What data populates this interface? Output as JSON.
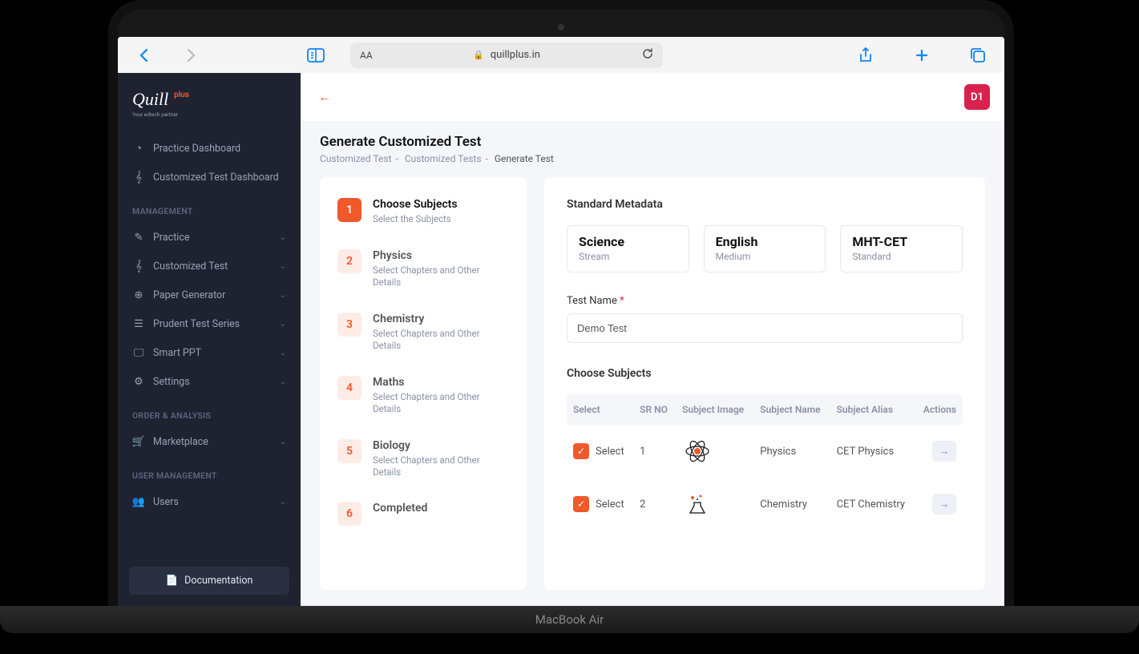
{
  "browser": {
    "url": "quillplus.in"
  },
  "laptop_label": "MacBook Air",
  "logo": {
    "main": "Quill",
    "plus": "plus",
    "tag": "Your edtech partner"
  },
  "sidebar": {
    "top": [
      {
        "label": "Practice Dashboard"
      },
      {
        "label": "Customized Test Dashboard"
      }
    ],
    "section1_title": "MANAGEMENT",
    "management": [
      {
        "label": "Practice"
      },
      {
        "label": "Customized Test"
      },
      {
        "label": "Paper Generator"
      },
      {
        "label": "Prudent Test Series"
      },
      {
        "label": "Smart PPT"
      },
      {
        "label": "Settings"
      }
    ],
    "section2_title": "ORDER & ANALYSIS",
    "order": [
      {
        "label": "Marketplace"
      }
    ],
    "section3_title": "USER MANAGEMENT",
    "user": [
      {
        "label": "Users"
      }
    ],
    "doc_btn": "Documentation"
  },
  "user_badge": "D1",
  "page": {
    "title": "Generate Customized Test",
    "crumbs": {
      "a": "Customized Test",
      "b": "Customized Tests",
      "c": "Generate Test"
    }
  },
  "steps": [
    {
      "n": "1",
      "title": "Choose Subjects",
      "sub": "Select the Subjects",
      "active": true
    },
    {
      "n": "2",
      "title": "Physics",
      "sub": "Select Chapters and Other Details",
      "active": false
    },
    {
      "n": "3",
      "title": "Chemistry",
      "sub": "Select Chapters and Other Details",
      "active": false
    },
    {
      "n": "4",
      "title": "Maths",
      "sub": "Select Chapters and Other Details",
      "active": false
    },
    {
      "n": "5",
      "title": "Biology",
      "sub": "Select Chapters and Other Details",
      "active": false
    },
    {
      "n": "6",
      "title": "Completed",
      "sub": "",
      "active": false
    }
  ],
  "metadata": {
    "section_title": "Standard Metadata",
    "cards": [
      {
        "value": "Science",
        "label": "Stream"
      },
      {
        "value": "English",
        "label": "Medium"
      },
      {
        "value": "MHT-CET",
        "label": "Standard"
      }
    ]
  },
  "test_name": {
    "label": "Test Name",
    "value": "Demo Test"
  },
  "subjects": {
    "section_title": "Choose Subjects",
    "columns": {
      "c0": "Select",
      "c1": "SR NO",
      "c2": "Subject Image",
      "c3": "Subject Name",
      "c4": "Subject Alias",
      "c5": "Actions"
    },
    "select_label": "Select",
    "rows": [
      {
        "sr": "1",
        "name": "Physics",
        "alias": "CET Physics"
      },
      {
        "sr": "2",
        "name": "Chemistry",
        "alias": "CET Chemistry"
      }
    ]
  }
}
